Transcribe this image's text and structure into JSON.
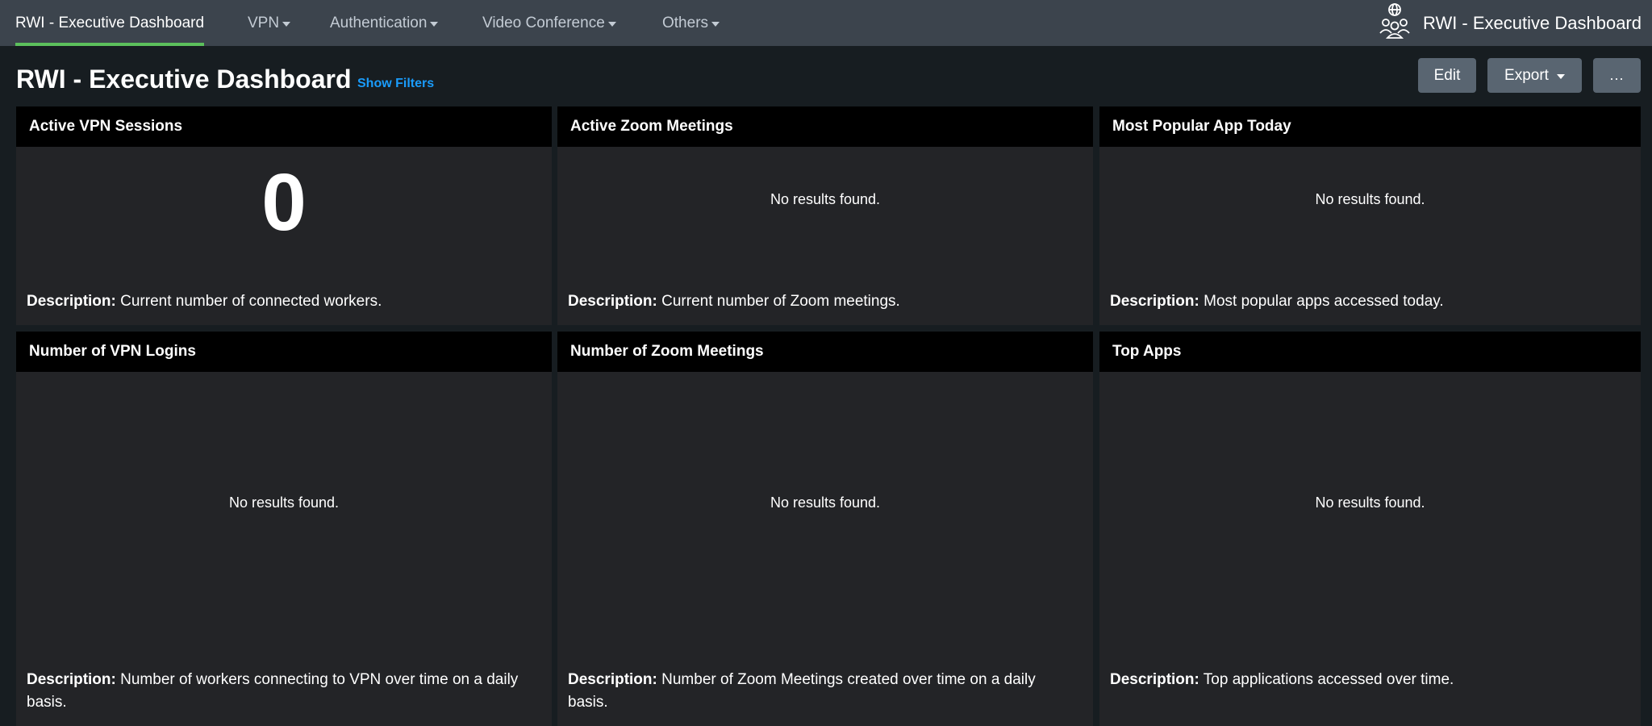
{
  "nav": {
    "items": [
      {
        "label": "RWI - Executive Dashboard",
        "active": true,
        "dropdown": false
      },
      {
        "label": "VPN",
        "active": false,
        "dropdown": true
      },
      {
        "label": "Authentication",
        "active": false,
        "dropdown": true
      },
      {
        "label": "Video Conference",
        "active": false,
        "dropdown": true
      },
      {
        "label": "Others",
        "active": false,
        "dropdown": true
      }
    ],
    "app_icon": "users-globe-icon",
    "app_title": "RWI - Executive Dashboard"
  },
  "header": {
    "title": "RWI - Executive Dashboard",
    "show_filters": "Show Filters",
    "edit": "Edit",
    "export": "Export",
    "more": "..."
  },
  "panels": [
    {
      "title": "Active VPN Sessions",
      "value": "0",
      "desc_label": "Description:",
      "desc_text": "Current number of connected workers."
    },
    {
      "title": "Active Zoom Meetings",
      "message": "No results found.",
      "desc_label": "Description:",
      "desc_text": "Current number of Zoom meetings."
    },
    {
      "title": "Most Popular App Today",
      "message": "No results found.",
      "desc_label": "Description:",
      "desc_text": "Most popular apps accessed today."
    },
    {
      "title": "Number of VPN Logins",
      "message": "No results found.",
      "desc_label": "Description:",
      "desc_text": "Number of workers connecting to VPN over time on a daily basis."
    },
    {
      "title": "Number of Zoom Meetings",
      "message": "No results found.",
      "desc_label": "Description:",
      "desc_text": "Number of Zoom Meetings created over time on a daily basis."
    },
    {
      "title": "Top Apps",
      "message": "No results found.",
      "desc_label": "Description:",
      "desc_text": "Top applications accessed over time."
    }
  ],
  "colors": {
    "nav_bg": "#3c444d",
    "page_bg": "#171d21",
    "panel_bg": "#232427",
    "panel_header_bg": "#000000",
    "active_tab": "#5cc05c",
    "link": "#1a9cfb",
    "button_bg": "#596571"
  }
}
